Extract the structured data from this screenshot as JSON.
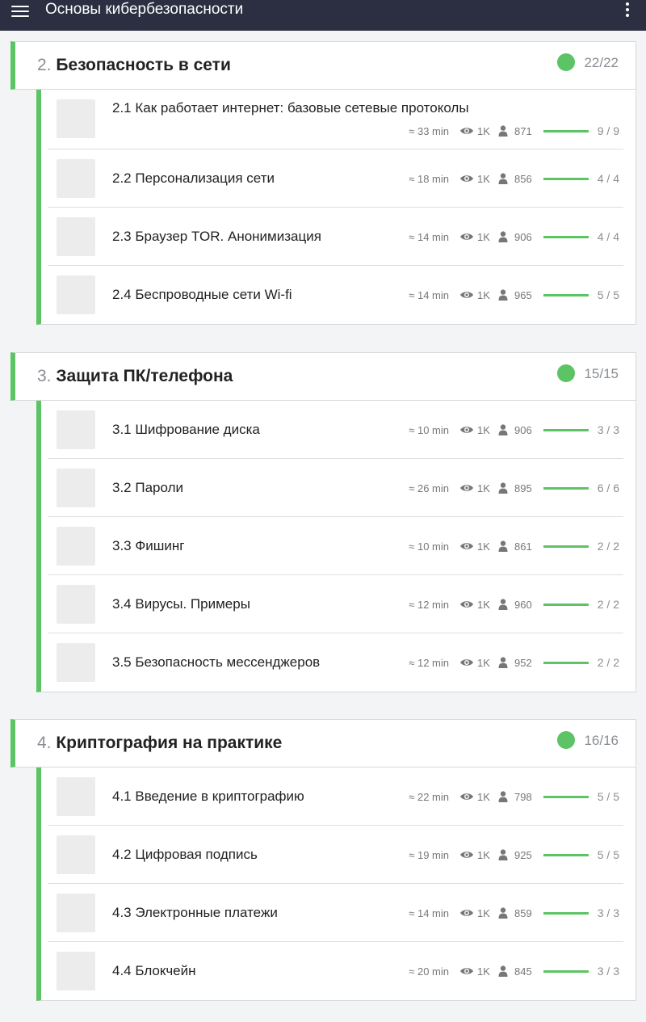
{
  "appbar": {
    "title": "Основы кибербезопасности"
  },
  "sections": [
    {
      "num": "2.",
      "title": "Безопасность в сети",
      "count": "22/22",
      "lessons": [
        {
          "title": "2.1 Как работает интернет: базовые сетевые протоколы",
          "duration": "≈ 33 min",
          "views": "1K",
          "learners": "871",
          "progress": "9 / 9",
          "completion": 1.0
        },
        {
          "title": "2.2 Персонализация сети",
          "duration": "≈ 18 min",
          "views": "1K",
          "learners": "856",
          "progress": "4 / 4",
          "completion": 1.0
        },
        {
          "title": "2.3 Браузер TOR. Анонимизация",
          "duration": "≈ 14 min",
          "views": "1K",
          "learners": "906",
          "progress": "4 / 4",
          "completion": 1.0
        },
        {
          "title": "2.4 Беспроводные сети Wi-fi",
          "duration": "≈ 14 min",
          "views": "1K",
          "learners": "965",
          "progress": "5 / 5",
          "completion": 1.0
        }
      ]
    },
    {
      "num": "3.",
      "title": "Защита ПК/телефона",
      "count": "15/15",
      "lessons": [
        {
          "title": "3.1 Шифрование диска",
          "duration": "≈ 10 min",
          "views": "1K",
          "learners": "906",
          "progress": "3 / 3",
          "completion": 1.0
        },
        {
          "title": "3.2 Пароли",
          "duration": "≈ 26 min",
          "views": "1K",
          "learners": "895",
          "progress": "6 / 6",
          "completion": 1.0
        },
        {
          "title": "3.3 Фишинг",
          "duration": "≈ 10 min",
          "views": "1K",
          "learners": "861",
          "progress": "2 / 2",
          "completion": 1.0
        },
        {
          "title": "3.4 Вирусы. Примеры",
          "duration": "≈ 12 min",
          "views": "1K",
          "learners": "960",
          "progress": "2 / 2",
          "completion": 1.0
        },
        {
          "title": "3.5 Безопасность мессенджеров",
          "duration": "≈ 12 min",
          "views": "1K",
          "learners": "952",
          "progress": "2 / 2",
          "completion": 1.0
        }
      ]
    },
    {
      "num": "4.",
      "title": "Криптография на практике",
      "count": "16/16",
      "lessons": [
        {
          "title": "4.1 Введение в криптографию",
          "duration": "≈ 22 min",
          "views": "1K",
          "learners": "798",
          "progress": "5 / 5",
          "completion": 1.0
        },
        {
          "title": "4.2 Цифровая подпись",
          "duration": "≈ 19 min",
          "views": "1K",
          "learners": "925",
          "progress": "5 / 5",
          "completion": 1.0
        },
        {
          "title": "4.3 Электронные платежи",
          "duration": "≈ 14 min",
          "views": "1K",
          "learners": "859",
          "progress": "3 / 3",
          "completion": 1.0
        },
        {
          "title": "4.4 Блокчейн",
          "duration": "≈ 20 min",
          "views": "1K",
          "learners": "845",
          "progress": "3 / 3",
          "completion": 1.0
        }
      ]
    }
  ],
  "icons": {
    "menu": "hamburger-menu-icon",
    "more": "more-vertical-icon",
    "views": "eye-icon",
    "learners": "person-icon",
    "done": "completed-dot-icon"
  },
  "colors": {
    "appbar": "#2b2f41",
    "accent": "#5dc465",
    "muted": "#8a8e94"
  }
}
